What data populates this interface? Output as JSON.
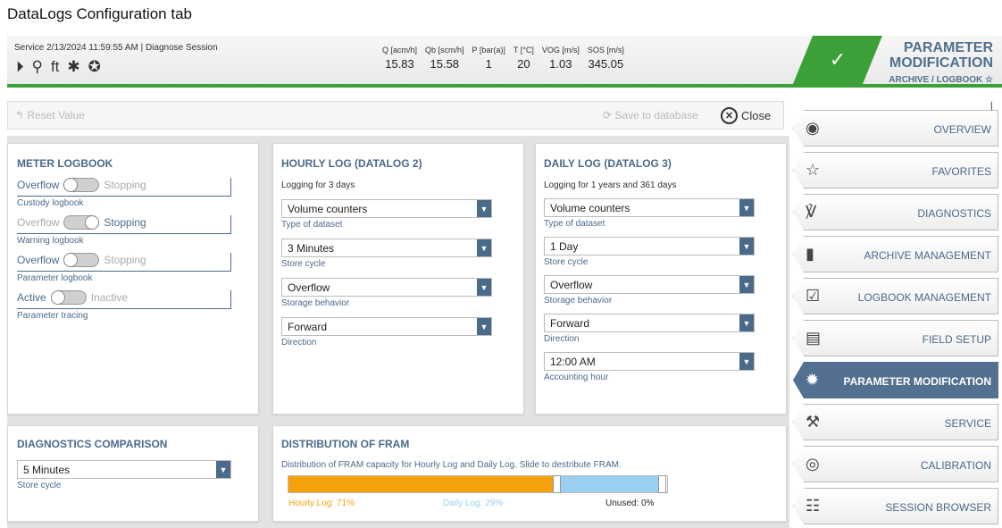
{
  "caption": "DataLogs Configuration tab",
  "header": {
    "session": "Service  2/13/2024  11:59:55 AM  |  Diagnose Session",
    "icons": [
      "play-icon",
      "user-settings-icon",
      "units-icon",
      "asterisk-icon",
      "certificate-icon"
    ],
    "icon_glyphs": [
      "⏵",
      "⚲",
      "ft",
      "✱",
      "✪"
    ],
    "readings": [
      {
        "label": "Q [acm/h]",
        "value": "15.83"
      },
      {
        "label": "Qb [scm/h]",
        "value": "15.58"
      },
      {
        "label": "P [bar(a)]",
        "value": "1"
      },
      {
        "label": "T [°C]",
        "value": "20"
      },
      {
        "label": "VOG [m/s]",
        "value": "1.03"
      },
      {
        "label": "SOS [m/s]",
        "value": "345.05"
      }
    ],
    "status_check": "✓",
    "mode_title_1": "PARAMETER",
    "mode_title_2": "MODIFICATION",
    "mode_sub": "ARCHIVE / LOGBOOK ☆"
  },
  "toolbar": {
    "reset": "↰ Reset Value",
    "save": "⟳ Save to database",
    "close": "Close",
    "close_glyph": "✕"
  },
  "meter_logbook": {
    "title": "METER LOGBOOK",
    "rows": [
      {
        "left": "Overflow",
        "right": "Stopping",
        "caption": "Custody logbook"
      },
      {
        "left": "Overflow",
        "right": "Stopping",
        "caption": "Warning logbook"
      },
      {
        "left": "Overflow",
        "right": "Stopping",
        "caption": "Parameter logbook"
      },
      {
        "left": "Active",
        "right": "Inactive",
        "caption": "Parameter tracing"
      }
    ]
  },
  "hourly_log": {
    "title": "HOURLY LOG (DATALOG 2)",
    "subtitle": "Logging for 3 days",
    "fields": [
      {
        "value": "Volume counters",
        "label": "Type of dataset"
      },
      {
        "value": "3 Minutes",
        "label": "Store cycle"
      },
      {
        "value": "Overflow",
        "label": "Storage behavior"
      },
      {
        "value": "Forward",
        "label": "Direction"
      }
    ]
  },
  "daily_log": {
    "title": "DAILY LOG (DATALOG 3)",
    "subtitle": "Logging for 1 years and 361 days",
    "fields": [
      {
        "value": "Volume counters",
        "label": "Type of dataset"
      },
      {
        "value": "1 Day",
        "label": "Store cycle"
      },
      {
        "value": "Overflow",
        "label": "Storage behavior"
      },
      {
        "value": "Forward",
        "label": "Direction"
      },
      {
        "value": "12:00 AM",
        "label": "Accounting hour"
      }
    ]
  },
  "diagnostics_comparison": {
    "title": "DIAGNOSTICS COMPARISON",
    "field": {
      "value": "5 Minutes",
      "label": "Store cycle"
    }
  },
  "fram": {
    "title": "DISTRIBUTION OF FRAM",
    "description": "Distribution of FRAM capacity for Hourly Log and Daily Log. Slide to destribute FRAM.",
    "hourly_label": "Hourly Log: 71%",
    "daily_label": "Daily Log: 29%",
    "unused_label": "Unused: 0%",
    "hourly_fraction": 0.71,
    "daily_fraction": 0.29,
    "colors": {
      "hourly": "#f5a10c",
      "daily": "#99cfef"
    }
  },
  "nav": {
    "top_icon": "ꟾ",
    "items": [
      {
        "label": "OVERVIEW",
        "icon": "globe-icon",
        "glyph": "◉",
        "active": false
      },
      {
        "label": "FAVORITES",
        "icon": "star-icon",
        "glyph": "☆",
        "active": false
      },
      {
        "label": "DIAGNOSTICS",
        "icon": "stethoscope-icon",
        "glyph": "℣",
        "active": false
      },
      {
        "label": "ARCHIVE MANAGEMENT",
        "icon": "book-icon",
        "glyph": "▮",
        "active": false
      },
      {
        "label": "LOGBOOK MANAGEMENT",
        "icon": "checkbook-icon",
        "glyph": "☑",
        "active": false
      },
      {
        "label": "FIELD SETUP",
        "icon": "document-settings-icon",
        "glyph": "▤",
        "active": false
      },
      {
        "label": "PARAMETER MODIFICATION",
        "icon": "gear-icon",
        "glyph": "✹",
        "active": true
      },
      {
        "label": "SERVICE",
        "icon": "wrench-icon",
        "glyph": "⚒",
        "active": false
      },
      {
        "label": "CALIBRATION",
        "icon": "calibration-icon",
        "glyph": "◎",
        "active": false
      },
      {
        "label": "SESSION BROWSER",
        "icon": "session-list-icon",
        "glyph": "☷",
        "active": false
      }
    ]
  },
  "colors": {
    "accent": "#52708f",
    "status_green": "#3aa037"
  }
}
